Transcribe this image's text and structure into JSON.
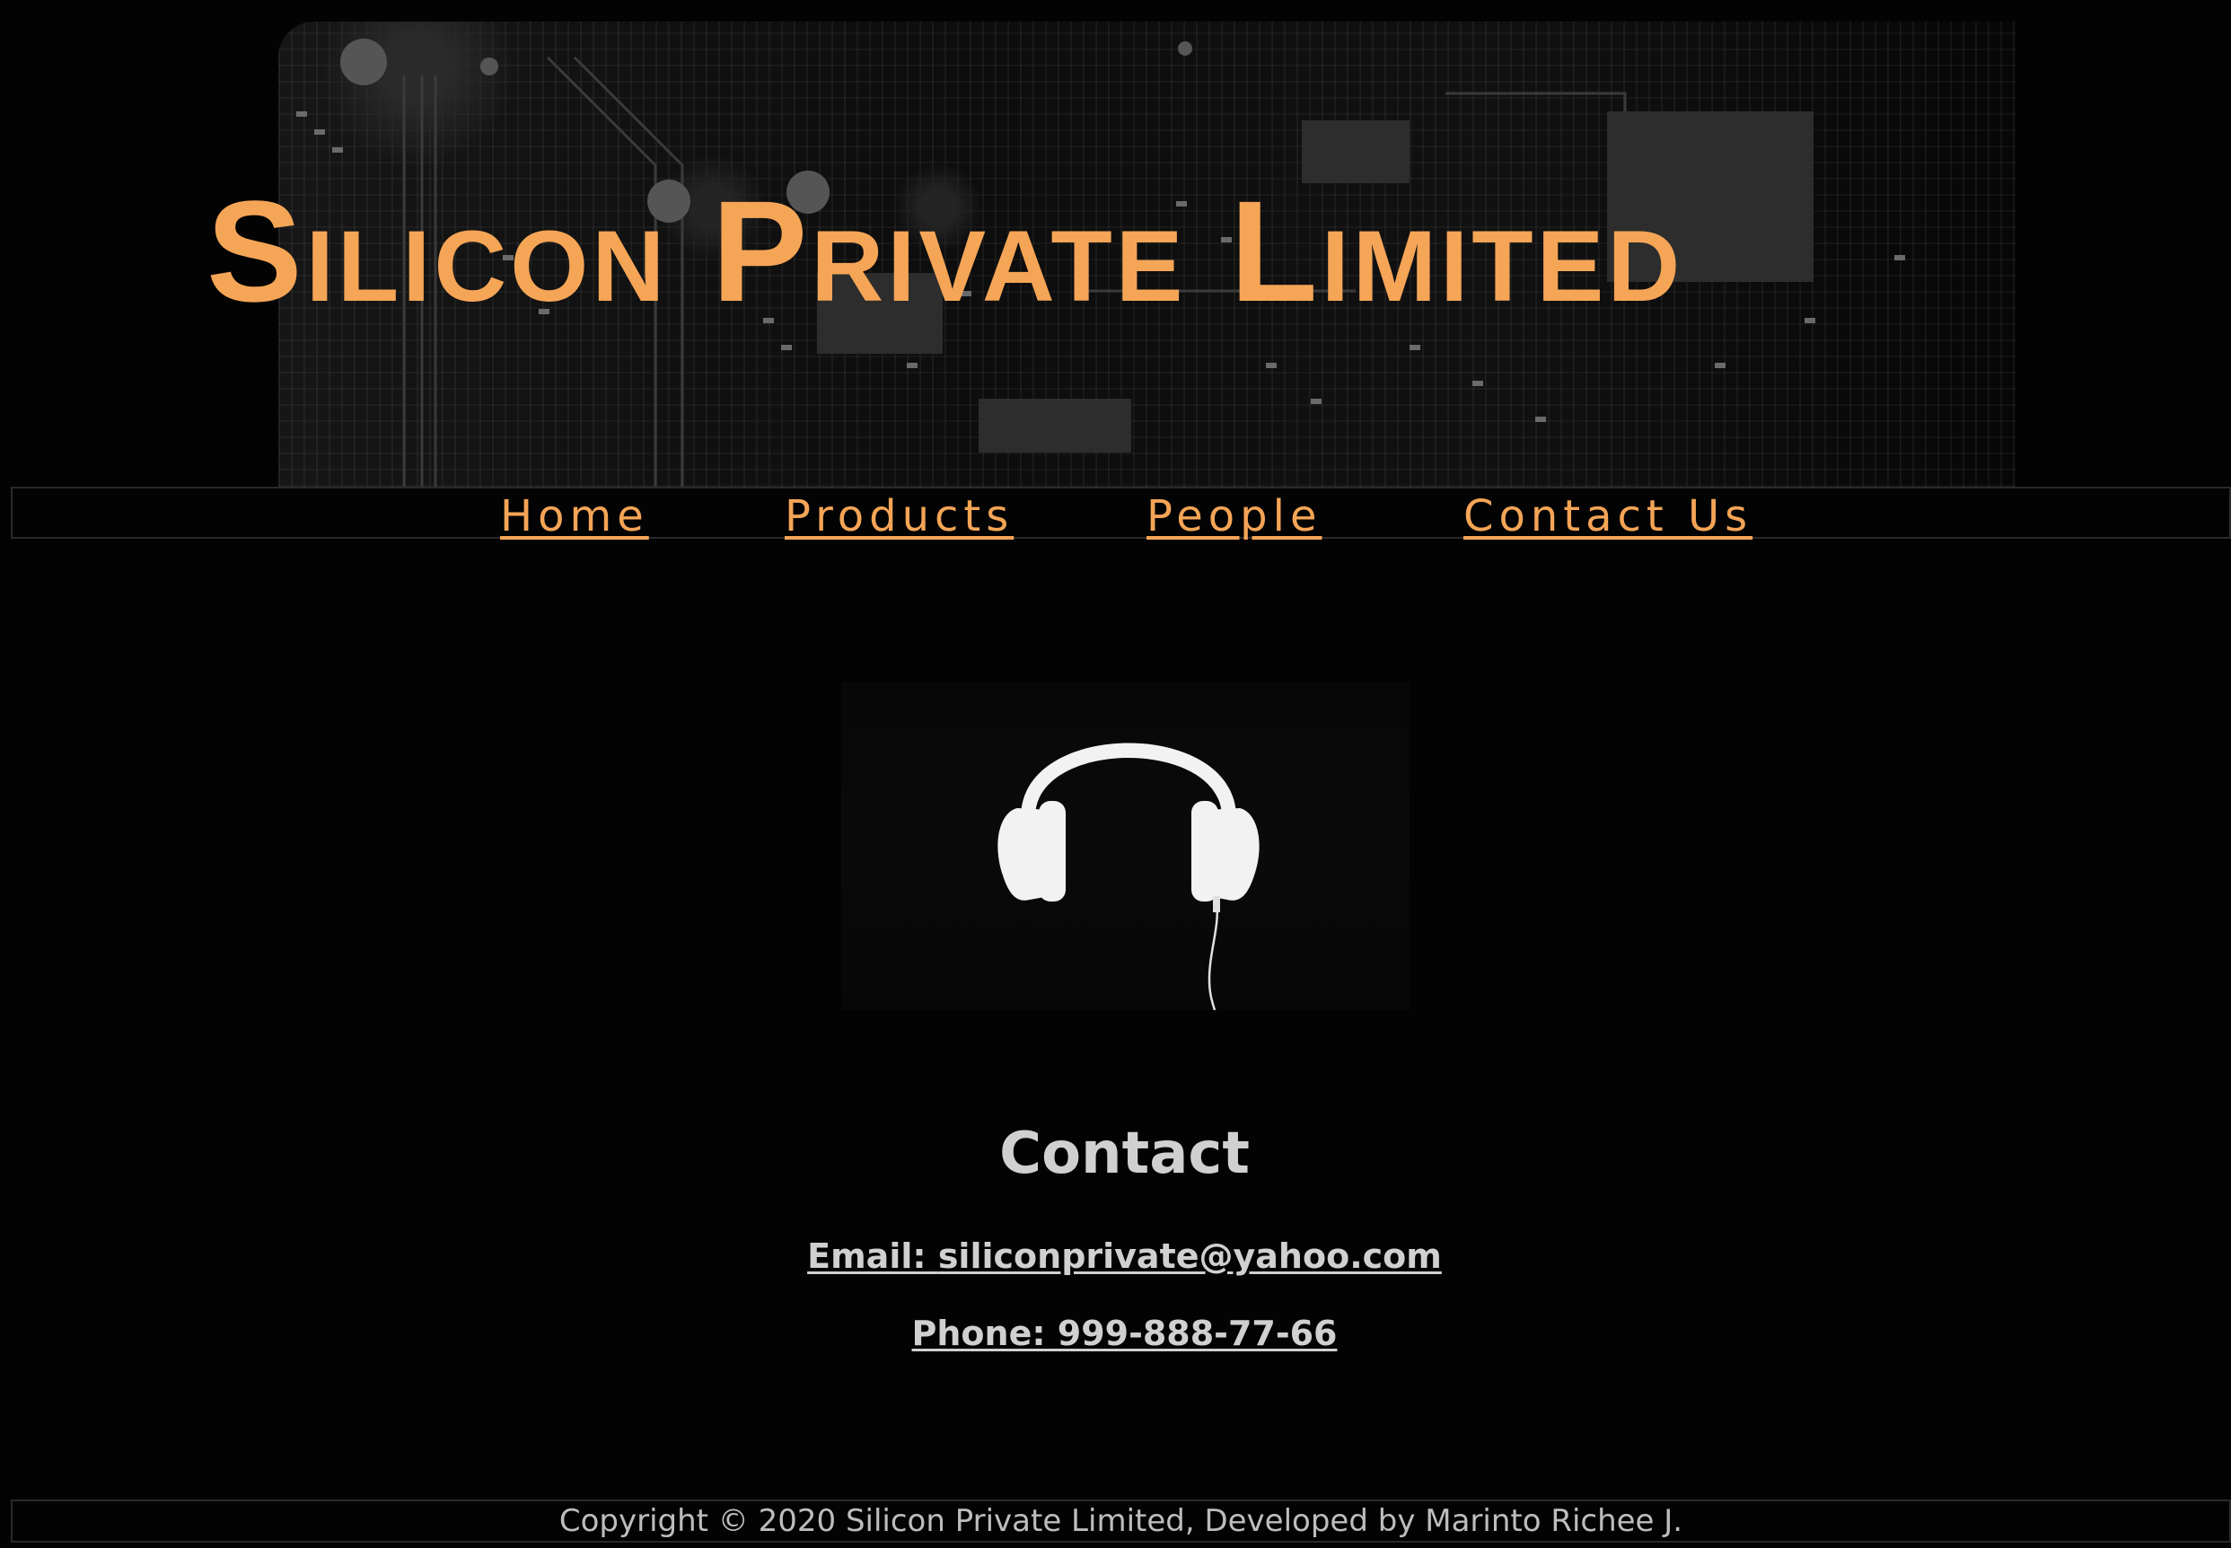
{
  "header": {
    "title": "Silicon Private Limited"
  },
  "nav": {
    "items": [
      {
        "label": "Home"
      },
      {
        "label": "Products"
      },
      {
        "label": "People"
      },
      {
        "label": "Contact Us"
      }
    ]
  },
  "hero_image": {
    "icon": "headphones-icon"
  },
  "contact": {
    "heading": "Contact",
    "email_label": "Email: ",
    "email_value": "siliconprivate@yahoo.com",
    "phone": "Phone: 999-888-77-66"
  },
  "footer": {
    "text": "Copyright © 2020 Silicon Private Limited, Developed by Marinto Richee J."
  },
  "colors": {
    "background": "#030303",
    "accent": "#f5a556",
    "text": "#d0d0d0"
  }
}
